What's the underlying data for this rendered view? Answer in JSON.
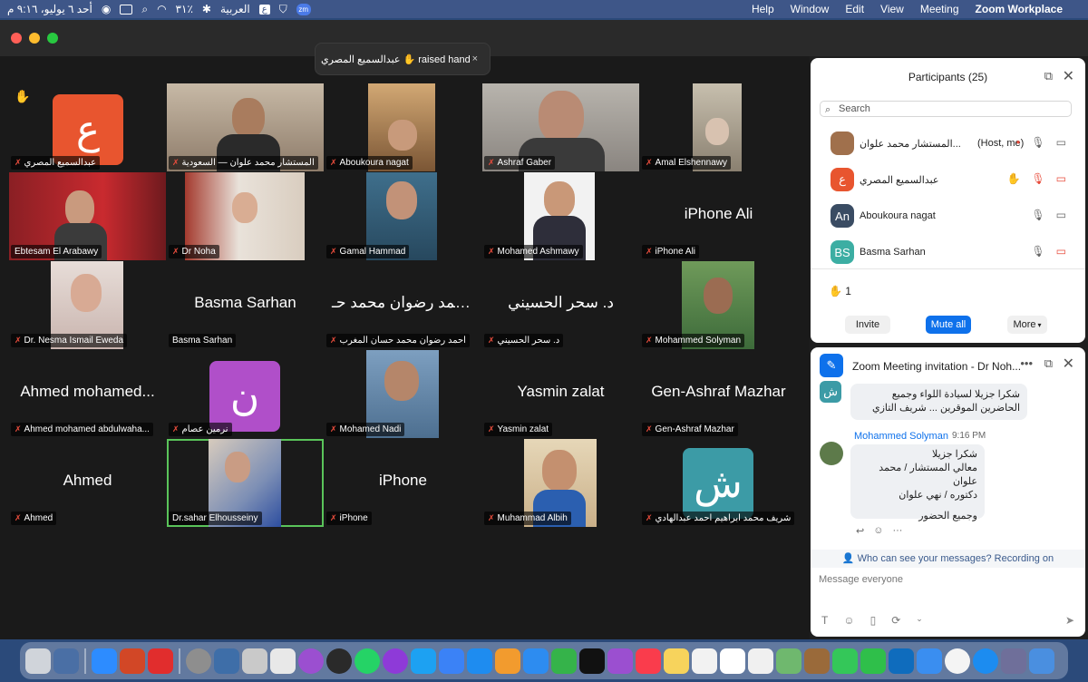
{
  "menubar": {
    "datetime": "أحد ٦ يوليو، ٩:١٦ م",
    "battery": "٣١٪",
    "language": "العربية",
    "app_name": "Zoom Workplace",
    "menus": [
      "Help",
      "Window",
      "Edit",
      "View",
      "Meeting"
    ]
  },
  "toast": {
    "text": "عبدالسميع المصري ✋ raised hand",
    "close": "×"
  },
  "tiles": [
    {
      "label": "عبدالسميع المصري",
      "big": "",
      "avatar": "ع",
      "avatar_color": "#e8552f",
      "muted": true,
      "hand": true
    },
    {
      "label": "المستشار محمد علوان — السعودية",
      "big": "",
      "muted": true
    },
    {
      "label": "Aboukoura nagat",
      "big": "",
      "muted": true
    },
    {
      "label": "Ashraf Gaber",
      "big": "",
      "muted": true
    },
    {
      "label": "Amal Elshennawy",
      "big": "",
      "muted": true
    },
    {
      "label": "Ebtesam El Arabawy",
      "big": "",
      "muted": false
    },
    {
      "label": "Dr Noha",
      "big": "",
      "muted": true
    },
    {
      "label": "Gamal Hammad",
      "big": "",
      "muted": true
    },
    {
      "label": "Mohamed Ashmawy",
      "big": "",
      "muted": true
    },
    {
      "label": "iPhone Ali",
      "big": "iPhone Ali",
      "muted": true
    },
    {
      "label": "Dr. Nesma Ismail Eweda",
      "big": "",
      "muted": true
    },
    {
      "label": "Basma Sarhan",
      "big": "Basma Sarhan",
      "muted": false
    },
    {
      "label": "احمد رضوان محمد حسان المغرب",
      "big": "احمد رضوان محمد حـ...",
      "muted": true
    },
    {
      "label": "د. سحر الحسيني",
      "big": "د. سحر الحسيني",
      "muted": true
    },
    {
      "label": "Mohammed Solyman",
      "big": "",
      "muted": true
    },
    {
      "label": "Ahmed mohamed abdulwaha...",
      "big": "Ahmed mohamed...",
      "muted": true
    },
    {
      "label": "نرمين عصام",
      "big": "",
      "avatar": "ن",
      "avatar_color": "#b04fc9",
      "muted": true
    },
    {
      "label": "Mohamed Nadi",
      "big": "",
      "muted": true
    },
    {
      "label": "Yasmin zalat",
      "big": "Yasmin zalat",
      "muted": true
    },
    {
      "label": "Gen-Ashraf Mazhar",
      "big": "Gen-Ashraf Mazhar",
      "muted": true
    },
    {
      "label": "Ahmed",
      "big": "Ahmed",
      "muted": true
    },
    {
      "label": "Dr.sahar Elhousseiny",
      "big": "",
      "muted": false
    },
    {
      "label": "iPhone",
      "big": "iPhone",
      "muted": true
    },
    {
      "label": "Muhammad Albih",
      "big": "",
      "muted": true
    },
    {
      "label": "شريف محمد ابراهيم احمد عبدالهادي",
      "big": "",
      "avatar": "ش",
      "avatar_color": "#3c9ba6",
      "muted": true
    }
  ],
  "participants": {
    "title": "Participants (25)",
    "search_placeholder": "Search",
    "list": [
      {
        "initials": "",
        "name": "المستشار محمد علوان...",
        "info": "(Host, me)",
        "color": "#a0704c"
      },
      {
        "initials": "ع",
        "name": "عبدالسميع المصري",
        "info": "",
        "color": "#e8552f"
      },
      {
        "initials": "An",
        "name": "Aboukoura nagat",
        "info": "",
        "color": "#3a4c63"
      },
      {
        "initials": "BS",
        "name": "Basma Sarhan",
        "info": "",
        "color": "#3caea3"
      }
    ],
    "hand_count": "1",
    "invite": "Invite",
    "mute_all": "Mute all",
    "more": "More"
  },
  "chat": {
    "title": "Zoom Meeting invitation - Dr Noh...",
    "first_avatar": "ش",
    "msg1": "شكرا جزيلا لسيادة اللواء وجميع الحاضرين الموقرين ... شريف التازي",
    "sender": "Mohammed Solyman",
    "time": "9:16 PM",
    "msg2_lines": [
      "شكرا جزيلا",
      "معالي المستشار / محمد علوان",
      "دكتوره / نهي علوان",
      "",
      "وجميع الحضور"
    ],
    "visibility": "Who can see your messages? Recording on",
    "input_placeholder": "Message everyone"
  }
}
